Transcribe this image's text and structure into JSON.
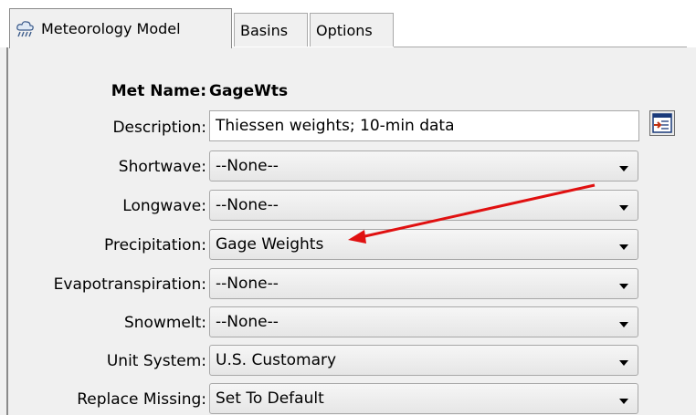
{
  "tabs": [
    {
      "label": "Meteorology Model",
      "icon": "cloud-rain-icon",
      "active": true
    },
    {
      "label": "Basins",
      "active": false
    },
    {
      "label": "Options",
      "active": false
    }
  ],
  "met_name": {
    "label": "Met Name:",
    "value": "GageWts"
  },
  "fields": {
    "description": {
      "label": "Description:",
      "value": "Thiessen weights; 10-min data"
    },
    "shortwave": {
      "label": "Shortwave:",
      "value": "--None--"
    },
    "longwave": {
      "label": "Longwave:",
      "value": "--None--"
    },
    "precipitation": {
      "label": "Precipitation:",
      "value": "Gage Weights"
    },
    "evapotranspiration": {
      "label": "Evapotranspiration:",
      "value": "--None--"
    },
    "snowmelt": {
      "label": "Snowmelt:",
      "value": "--None--"
    },
    "unit_system": {
      "label": "Unit System:",
      "value": "U.S. Customary"
    },
    "replace_missing": {
      "label": "Replace Missing:",
      "value": "Set To Default"
    }
  },
  "annotation": {
    "color": "#e01010",
    "icon": "red-arrow-annotation"
  }
}
